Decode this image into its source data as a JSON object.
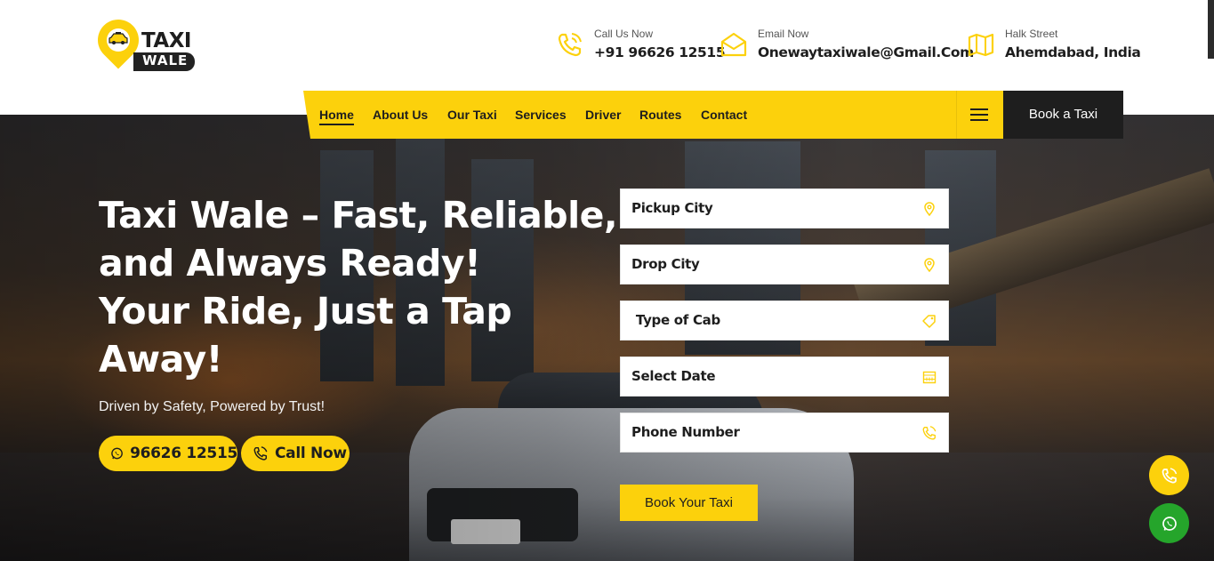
{
  "brand": {
    "logo_top": "TAXI",
    "logo_bottom": "WALE",
    "logo_icon": "taxi-pin-icon"
  },
  "colors": {
    "accent": "#fcd10c",
    "dark": "#1e1e1e",
    "whatsapp": "#25a52b"
  },
  "contacts": [
    {
      "icon": "phone-ring-icon",
      "label": "Call Us Now",
      "value": "+91 96626 12515"
    },
    {
      "icon": "envelope-icon",
      "label": "Email Now",
      "value": "Onewaytaxiwale@Gmail.Com"
    },
    {
      "icon": "map-icon",
      "label": "Halk Street",
      "value": "Ahemdabad, India"
    }
  ],
  "nav": {
    "items": [
      "Home",
      "About Us",
      "Our Taxi",
      "Services",
      "Driver",
      "Routes",
      "Contact"
    ],
    "active": "Home",
    "menu_icon": "hamburger-icon",
    "cta": "Book a Taxi"
  },
  "hero": {
    "title_lines": [
      "Taxi Wale – Fast, Reliable,",
      "and Always Ready!",
      "Your Ride, Just a Tap",
      "Away!"
    ],
    "subtitle": "Driven by Safety, Powered by Trust!",
    "whatsapp_number": "96626 12515",
    "call_label": "Call Now"
  },
  "booking_form": {
    "fields": [
      {
        "label": "Pickup City",
        "icon": "location-pin-icon"
      },
      {
        "label": "Drop City",
        "icon": "location-pin-icon"
      },
      {
        "label": " Type of Cab",
        "icon": "tag-icon"
      },
      {
        "label": "Select Date",
        "icon": "calendar-icon"
      },
      {
        "label": "Phone Number",
        "icon": "phone-ring-icon"
      }
    ],
    "submit": "Book Your Taxi"
  },
  "floating_buttons": [
    {
      "icon": "phone-ring-icon",
      "color": "#fcd10c"
    },
    {
      "icon": "whatsapp-icon",
      "color": "#25a52b"
    }
  ]
}
